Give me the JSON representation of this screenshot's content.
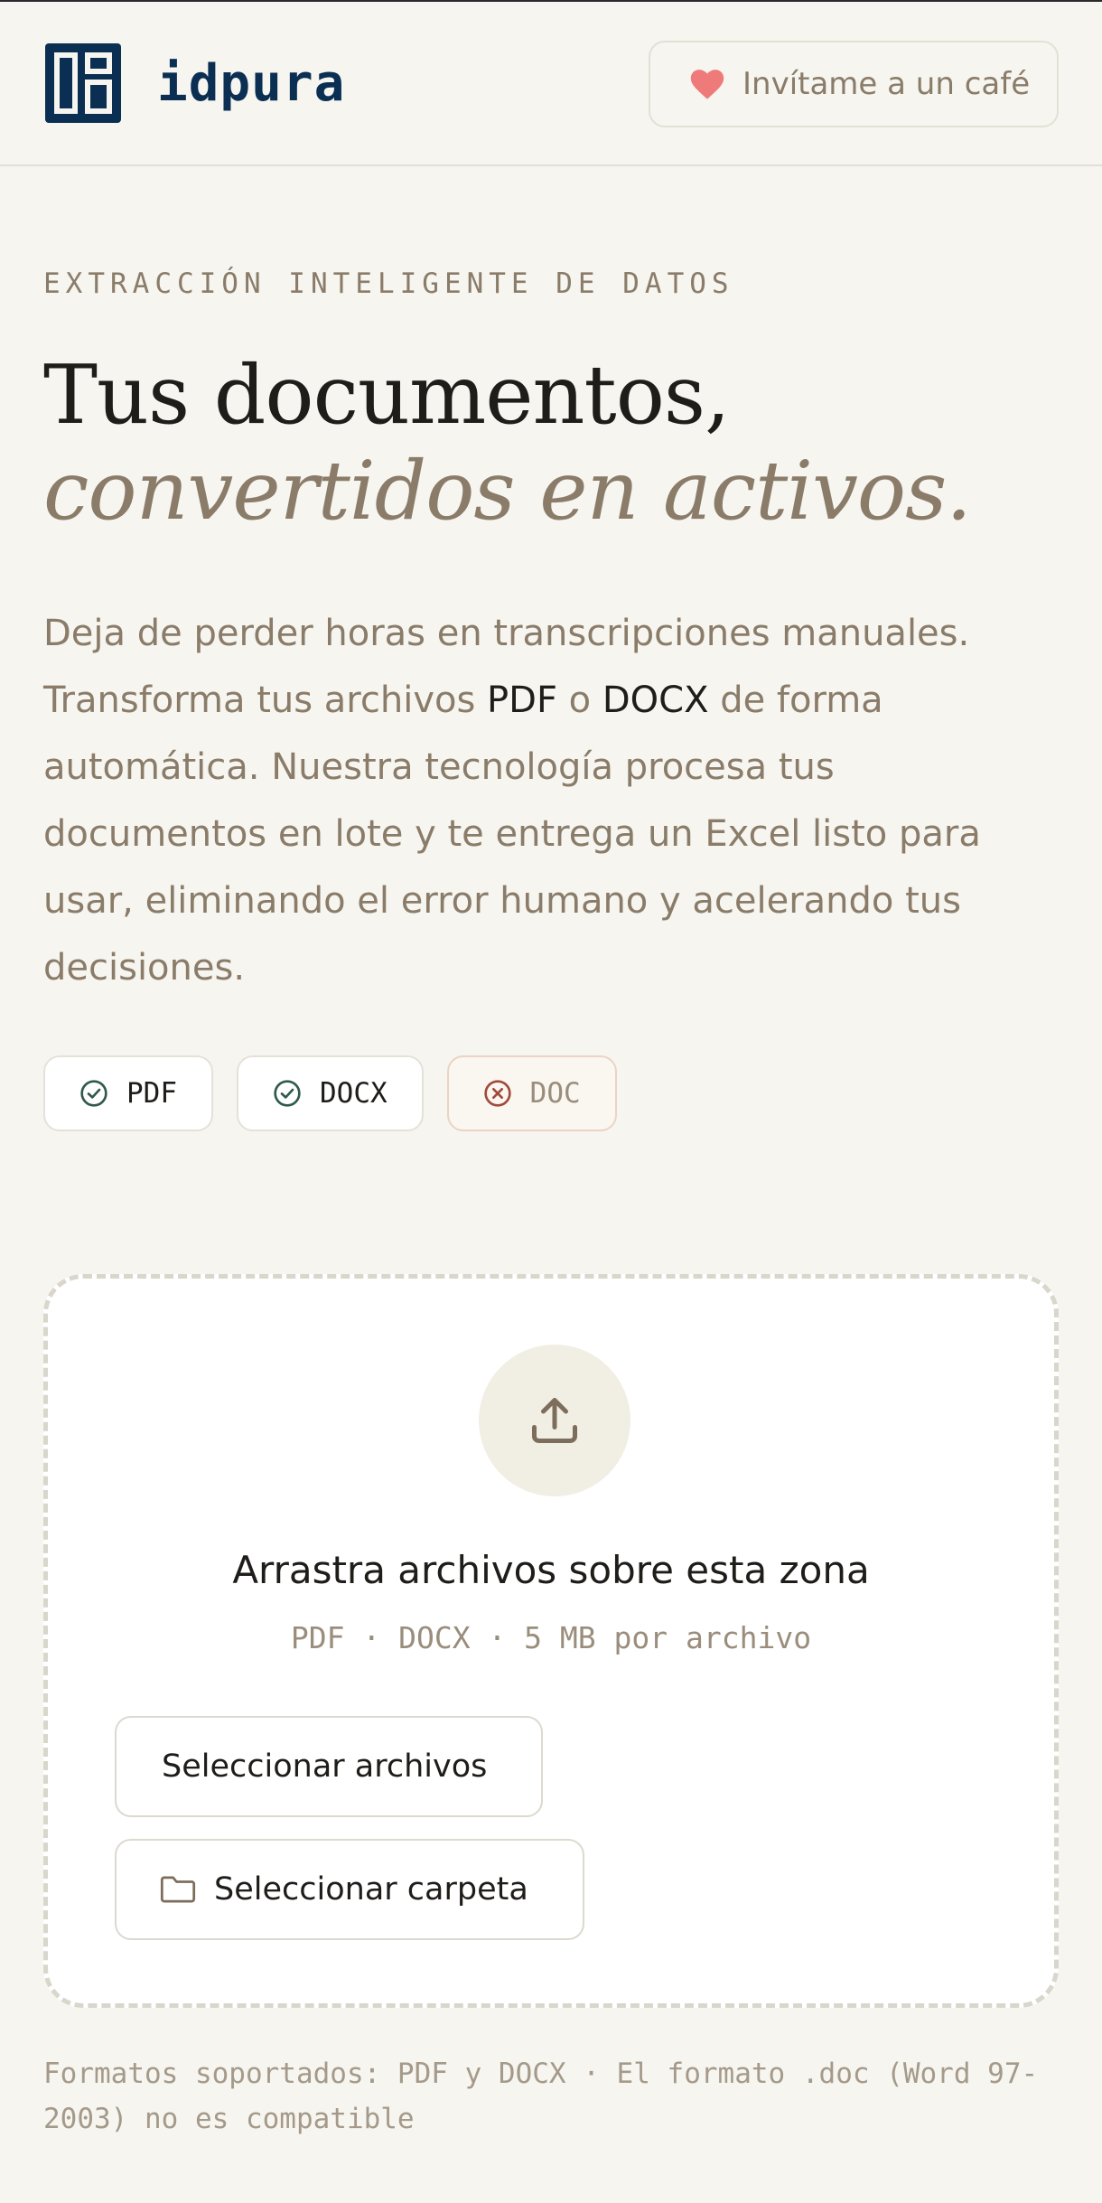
{
  "header": {
    "brand": "idpura",
    "coffee_label": "Invítame a un café"
  },
  "hero": {
    "eyebrow": "EXTRACCIÓN INTELIGENTE DE DATOS",
    "title": "Tus documentos,",
    "subtitle": "convertidos en activos.",
    "desc_1": "Deja de perder horas en transcripciones manuales. Transforma tus archivos ",
    "desc_pdf": "PDF",
    "desc_2": " o ",
    "desc_docx": "DOCX",
    "desc_3": " de forma automática. Nuestra tecnología procesa tus documentos en lote y te entrega un Excel listo para usar, eliminando el error humano y acelerando tus decisiones."
  },
  "formats": [
    {
      "label": "PDF",
      "supported": true
    },
    {
      "label": "DOCX",
      "supported": true
    },
    {
      "label": "DOC",
      "supported": false
    }
  ],
  "dropzone": {
    "title": "Arrastra archivos sobre esta zona",
    "hint": "PDF · DOCX · 5 MB por archivo",
    "select_files": "Seleccionar archivos",
    "select_folder": "Seleccionar carpeta"
  },
  "footnote": "Formatos soportados: PDF y DOCX · El formato .doc (Word 97-2003) no es compatible",
  "colors": {
    "background": "#f6f5f0",
    "brand_navy": "#0b2f52",
    "muted_taupe": "#8a7c69",
    "heart": "#ef7a7a",
    "check_green": "#2f5a4b",
    "cross_red": "#a14a3c"
  },
  "icons": {
    "logo": "brand-logo-icon",
    "coffee": "heart-icon",
    "supported": "check-circle-icon",
    "unsupported": "x-circle-icon",
    "upload": "upload-icon",
    "folder": "folder-icon"
  }
}
